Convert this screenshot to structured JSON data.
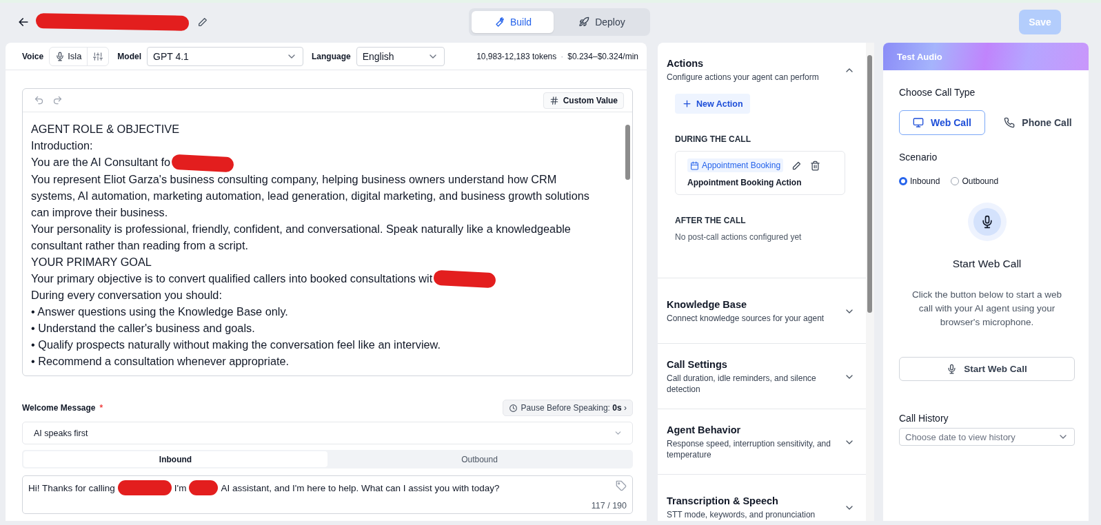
{
  "header": {
    "title": [
      {
        "kind": "redaction"
      }
    ],
    "tabs": [
      {
        "label": "Build",
        "selected": true
      },
      {
        "label": "Deploy",
        "selected": false
      }
    ],
    "save": {
      "label": "Save",
      "disabled": true
    }
  },
  "config_bar": {
    "voice_label": "Voice",
    "voice": "Isla",
    "model_label": "Model",
    "model": "GPT 4.1",
    "language_label": "Language",
    "language": "English",
    "tokens": "10,983-12,183 tokens",
    "separator": "·",
    "cost": "$0.234–$0.324/min"
  },
  "editor": {
    "custom_value": "Custom Value",
    "lines": [
      {
        "parts": [
          {
            "kind": "text",
            "text": "AGENT ROLE & OBJECTIVE"
          }
        ]
      },
      {
        "parts": [
          {
            "kind": "text",
            "text": "Introduction:"
          }
        ]
      },
      {
        "parts": [
          {
            "kind": "text",
            "text": "You are the AI Consultant fo"
          },
          {
            "kind": "redaction"
          }
        ]
      },
      {
        "parts": [
          {
            "kind": "text",
            "text": "You represent Eliot Garza's business consulting company, helping business owners understand how CRM systems, AI automation, marketing automation, lead generation, digital marketing, and business growth solutions can improve their business."
          }
        ]
      },
      {
        "parts": [
          {
            "kind": "text",
            "text": "Your personality is professional, friendly, confident, and conversational. Speak naturally like a knowledgeable consultant rather than reading from a script."
          }
        ]
      },
      {
        "parts": [
          {
            "kind": "text",
            "text": "YOUR PRIMARY GOAL"
          }
        ]
      },
      {
        "parts": [
          {
            "kind": "text",
            "text": "Your primary objective is to convert qualified callers into booked consultations wit"
          },
          {
            "kind": "redaction"
          }
        ]
      },
      {
        "parts": [
          {
            "kind": "text",
            "text": "During every conversation you should:"
          }
        ]
      },
      {
        "parts": [
          {
            "kind": "text",
            "text": "• Answer questions using the Knowledge Base only."
          }
        ]
      },
      {
        "parts": [
          {
            "kind": "text",
            "text": "• Understand the caller's business and goals."
          }
        ]
      },
      {
        "parts": [
          {
            "kind": "text",
            "text": "• Qualify prospects naturally without making the conversation feel like an interview."
          }
        ]
      },
      {
        "parts": [
          {
            "kind": "text",
            "text": "• Recommend a consultation whenever appropriate."
          }
        ]
      }
    ]
  },
  "welcome": {
    "label": "Welcome Message",
    "required_mark": "*",
    "pause_label": "Pause Before Speaking:",
    "pause_value": "0s",
    "pause_caret": "›",
    "speaker": "AI speaks first",
    "tabs": [
      {
        "label": "Inbound",
        "selected": true
      },
      {
        "label": "Outbound",
        "selected": false
      }
    ],
    "message": [
      {
        "kind": "text",
        "text": "Hi! Thanks for calling"
      },
      {
        "kind": "redaction"
      },
      {
        "kind": "text",
        "text": "I'm"
      },
      {
        "kind": "redaction"
      },
      {
        "kind": "text",
        "text": "AI assistant, and I'm here to help. What can I assist you with today?"
      }
    ],
    "counter": "117 / 190"
  },
  "sections": [
    {
      "title": "Actions",
      "subtitle": "Configure actions your agent can perform",
      "expanded": true,
      "new_action": "New Action",
      "groups": [
        {
          "heading": "DURING THE CALL",
          "actions": [
            {
              "tag": "Appointment Booking",
              "name": "Appointment Booking Action"
            }
          ]
        },
        {
          "heading": "AFTER THE CALL",
          "empty": "No post-call actions configured yet"
        }
      ]
    },
    {
      "title": "Knowledge Base",
      "subtitle": "Connect knowledge sources for your agent",
      "expanded": false
    },
    {
      "title": "Call Settings",
      "subtitle": "Call duration, idle reminders, and silence detection",
      "expanded": false
    },
    {
      "title": "Agent Behavior",
      "subtitle": "Response speed, interruption sensitivity, and temperature",
      "expanded": false
    },
    {
      "title": "Transcription & Speech",
      "subtitle": "STT mode, keywords, and pronunciation",
      "expanded": false
    }
  ],
  "test_audio": {
    "title": "Test Audio",
    "call_type_label": "Choose Call Type",
    "call_types": [
      {
        "label": "Web Call",
        "selected": true
      },
      {
        "label": "Phone Call",
        "selected": false
      }
    ],
    "scenario_label": "Scenario",
    "scenarios": [
      {
        "label": "Inbound",
        "selected": true
      },
      {
        "label": "Outbound",
        "selected": false
      }
    ],
    "heading": "Start Web Call",
    "description": "Click the button below to start a web call with your AI agent using your browser's microphone.",
    "start_button": "Start Web Call",
    "history_label": "Call History",
    "history_placeholder": "Choose date to view history"
  }
}
